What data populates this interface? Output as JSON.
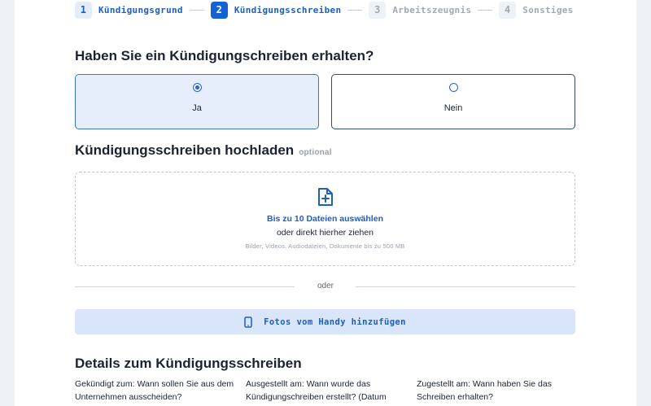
{
  "stepper": [
    {
      "num": "1",
      "label": "Kündigungsgrund",
      "state": "done"
    },
    {
      "num": "2",
      "label": "Kündigungsschreiben",
      "state": "active"
    },
    {
      "num": "3",
      "label": "Arbeitszeugnis",
      "state": "todo"
    },
    {
      "num": "4",
      "label": "Sonstiges",
      "state": "todo"
    }
  ],
  "question": {
    "title": "Haben Sie ein Kündigungschreiben erhalten?",
    "options": [
      {
        "label": "Ja",
        "selected": true
      },
      {
        "label": "Nein",
        "selected": false
      }
    ]
  },
  "upload": {
    "title": "Kündigungsschreiben hochladen",
    "optional": "optional",
    "select_label": "Bis zu 10 Dateien auswählen",
    "drag_label": "oder direkt hierher ziehen",
    "hint": "Bilder, Videos, Audiodateien, Dokumente bis zu 500 MB",
    "icon": "file-plus-icon"
  },
  "divider_text": "oder",
  "phone_button": {
    "label": "Fotos vom Handy hinzufügen",
    "icon": "smartphone-icon"
  },
  "details": {
    "title": "Details zum Kündigungsschreiben",
    "fields": [
      {
        "label": "Gekündigt zum: Wann sollen Sie aus dem Unternehmen ausscheiden?"
      },
      {
        "label": "Ausgestellt am: Wann wurde das Kündigungschreiben erstellt? (Datum"
      },
      {
        "label": "Zugestellt am: Wann haben Sie das Schreiben erhalten?"
      }
    ]
  },
  "colors": {
    "accent": "#1462d3",
    "selected_bg": "#e6eefb",
    "button_bg": "#d9e5f8"
  }
}
